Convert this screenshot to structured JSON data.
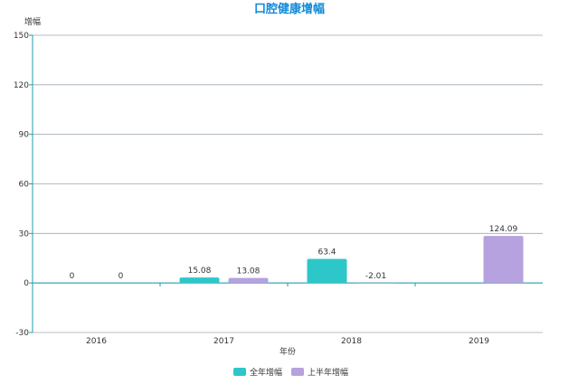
{
  "chart_data": {
    "type": "bar",
    "title": "口腔健康增幅",
    "ylabel": "增幅",
    "xlabel": "年份",
    "categories": [
      "2016",
      "2017",
      "2018",
      "2019"
    ],
    "ylim": [
      -30,
      150
    ],
    "yticks": [
      -30,
      0,
      30,
      60,
      90,
      120,
      150
    ],
    "grid": true,
    "legend_position": "bottom",
    "series": [
      {
        "name": "全年增幅",
        "color": "#2ec7c9",
        "values": [
          0,
          3.3,
          14.6,
          0
        ],
        "labels": [
          "0",
          "15.08",
          "63.4",
          ""
        ]
      },
      {
        "name": "上半年增幅",
        "color": "#b6a2de",
        "values": [
          0,
          3.0,
          -0.4,
          28.5
        ],
        "labels": [
          "0",
          "13.08",
          "-2.01",
          "124.09"
        ]
      }
    ],
    "title_color": "#0e8ad8",
    "axis_color": "#1e9eb0",
    "grid_color": "#9aa8b0"
  }
}
